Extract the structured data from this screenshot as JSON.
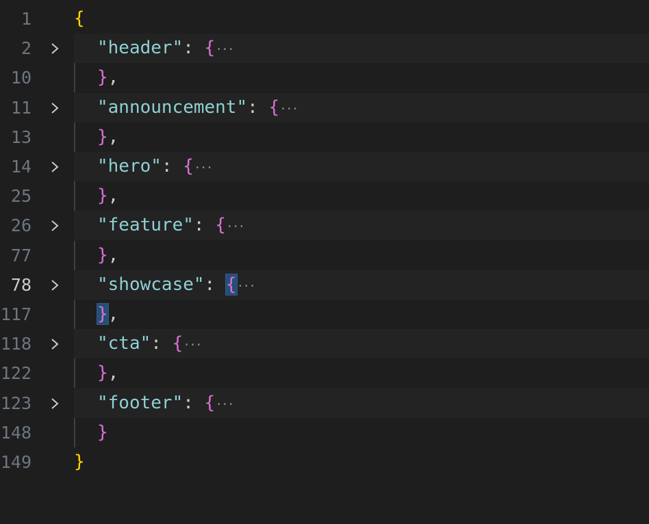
{
  "editor": {
    "colors": {
      "background": "#1e1e1e",
      "line_number": "#6e7681",
      "line_number_active": "#cccccc",
      "key": "#8fd0d4",
      "brace_outer": "#ffd700",
      "brace_inner": "#da70d6",
      "bracket_match_bg": "#264f78"
    },
    "lines": [
      {
        "num": "1",
        "indent": 0,
        "open": "{",
        "close": "",
        "key": "",
        "fold": false
      },
      {
        "num": "2",
        "indent": 1,
        "key": "\"header\"",
        "colon": ": ",
        "open": "{",
        "ellipsis": "···",
        "fold": true
      },
      {
        "num": "10",
        "indent": 1,
        "close": "}",
        "comma": ",",
        "fold": false
      },
      {
        "num": "11",
        "indent": 1,
        "key": "\"announcement\"",
        "colon": ": ",
        "open": "{",
        "ellipsis": "···",
        "fold": true
      },
      {
        "num": "13",
        "indent": 1,
        "close": "}",
        "comma": ",",
        "fold": false
      },
      {
        "num": "14",
        "indent": 1,
        "key": "\"hero\"",
        "colon": ": ",
        "open": "{",
        "ellipsis": "···",
        "fold": true
      },
      {
        "num": "25",
        "indent": 1,
        "close": "}",
        "comma": ",",
        "fold": false
      },
      {
        "num": "26",
        "indent": 1,
        "key": "\"feature\"",
        "colon": ": ",
        "open": "{",
        "ellipsis": "···",
        "fold": true
      },
      {
        "num": "77",
        "indent": 1,
        "close": "}",
        "comma": ",",
        "fold": false
      },
      {
        "num": "78",
        "indent": 1,
        "key": "\"showcase\"",
        "colon": ": ",
        "open": "{",
        "ellipsis": "···",
        "fold": true,
        "active": true,
        "match": true
      },
      {
        "num": "117",
        "indent": 1,
        "close": "}",
        "comma": ",",
        "fold": false,
        "match": true
      },
      {
        "num": "118",
        "indent": 1,
        "key": "\"cta\"",
        "colon": ": ",
        "open": "{",
        "ellipsis": "···",
        "fold": true
      },
      {
        "num": "122",
        "indent": 1,
        "close": "}",
        "comma": ",",
        "fold": false
      },
      {
        "num": "123",
        "indent": 1,
        "key": "\"footer\"",
        "colon": ": ",
        "open": "{",
        "ellipsis": "···",
        "fold": true
      },
      {
        "num": "148",
        "indent": 1,
        "close": "}",
        "comma": "",
        "fold": false
      },
      {
        "num": "149",
        "indent": 0,
        "close": "}",
        "comma": "",
        "fold": false
      }
    ],
    "icons": {
      "fold": "chevron-right-icon"
    }
  }
}
